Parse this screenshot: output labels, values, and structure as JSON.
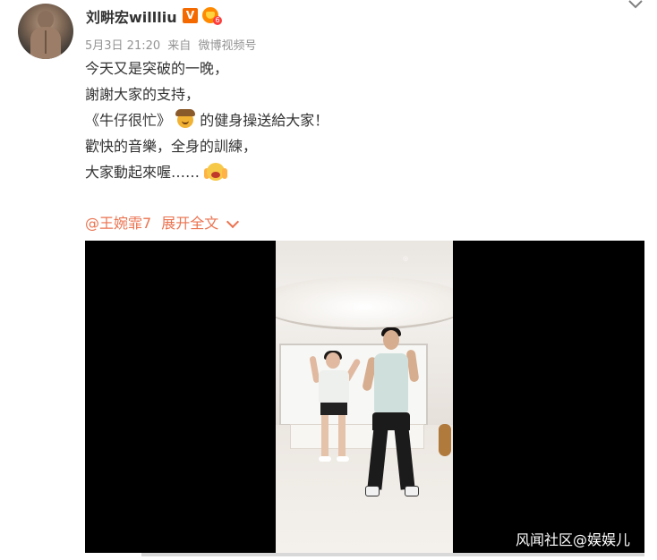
{
  "post": {
    "author": "刘畊宏willliu",
    "verified_badge": "V",
    "level_badge": "6",
    "meta": {
      "date": "5月3日 21:20",
      "source_prefix": "来自",
      "source": "微博视频号"
    },
    "content_lines": [
      "今天又是突破的一晚，",
      "謝謝大家的支持，",
      "《牛仔很忙》",
      "的健身操送給大家！",
      "歡快的音樂，全身的訓練，",
      "大家動起來喔……"
    ],
    "mention": "@王婉霏7",
    "expand_label": "展开全文"
  },
  "video": {
    "watermark_text": "风闻社区@娱娱儿"
  },
  "icons": {
    "more": "chevron-down-icon",
    "cowboy_emoji": "cowboy-emoji-icon",
    "fear_emoji": "scream-emoji-icon"
  },
  "colors": {
    "link": "#eb7350",
    "meta": "#939393",
    "verified": "#f56a00"
  }
}
